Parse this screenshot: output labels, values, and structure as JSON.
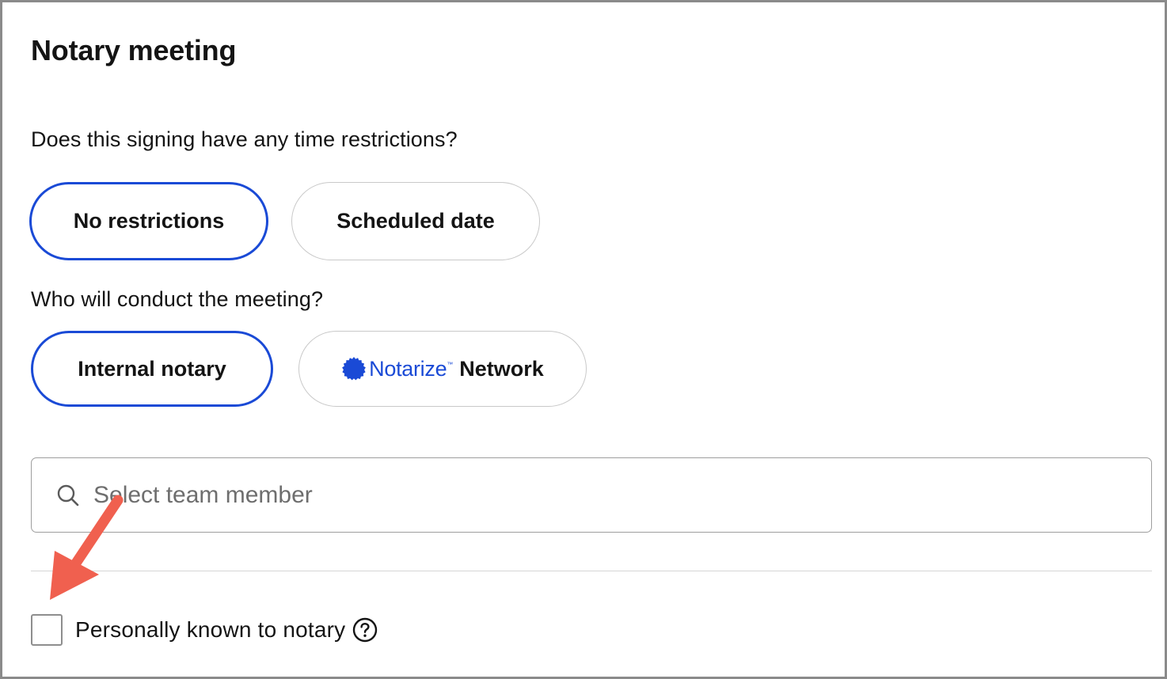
{
  "panel": {
    "title": "Notary meeting"
  },
  "time_restrictions": {
    "question": "Does this signing have any time restrictions?",
    "options": [
      {
        "label": "No restrictions",
        "selected": true
      },
      {
        "label": "Scheduled date",
        "selected": false
      }
    ]
  },
  "conductor": {
    "question": "Who will conduct the meeting?",
    "options": [
      {
        "label": "Internal notary",
        "selected": true
      },
      {
        "brand": "Notarize",
        "trademark": "™",
        "label": "Network",
        "selected": false
      }
    ]
  },
  "team_member_search": {
    "placeholder": "Select team member",
    "value": ""
  },
  "personally_known": {
    "label": "Personally known to notary",
    "checked": false
  },
  "colors": {
    "accent": "#1a4ad6",
    "annotation_arrow": "#f0604f",
    "text": "#141414",
    "border_muted": "#c9c9c9"
  },
  "icons": {
    "search": "search-icon",
    "help": "question-circle-icon",
    "brand": "notarize-seal-icon",
    "annotation": "arrow-icon"
  }
}
